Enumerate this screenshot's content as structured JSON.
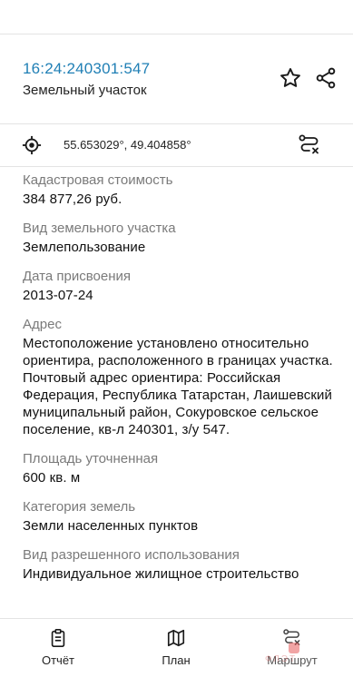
{
  "header": {
    "cadastral_number": "16:24:240301:547",
    "object_type": "Земельный участок",
    "favorite_icon": "star-outline-icon",
    "share_icon": "share-icon"
  },
  "location": {
    "coordinates": "55.653029°, 49.404858°",
    "locate_icon": "target-icon",
    "route_icon": "route-icon"
  },
  "properties": [
    {
      "label": "Кадастровая стоимость",
      "value": "384 877,26 руб."
    },
    {
      "label": "Вид земельного участка",
      "value": "Землепользование"
    },
    {
      "label": "Дата присвоения",
      "value": "2013-07-24"
    },
    {
      "label": "Адрес",
      "value": "Местоположение установлено относительно ориентира, расположенного в границах участка. Почтовый адрес ориентира: Российская Федерация, Республика Татарстан, Лаишевский муниципальный район, Сокуровское сельское поселение, кв-л 240301, з/у 547."
    },
    {
      "label": "Площадь уточненная",
      "value": "600 кв. м"
    },
    {
      "label": "Категория земель",
      "value": "Земли населенных пунктов"
    },
    {
      "label": "Вид разрешенного использования",
      "value": "Индивидуальное жилищное строительство"
    }
  ],
  "tabs": {
    "report": {
      "label": "Отчёт",
      "icon": "clipboard-icon"
    },
    "plan": {
      "label": "План",
      "icon": "map-icon"
    },
    "route": {
      "label": "Маршрут",
      "icon": "route-icon"
    }
  },
  "colors": {
    "accent": "#1f7fb5",
    "label": "#7a7a7a",
    "divider": "#e4e4e4"
  },
  "watermark": "ФЛЭТ"
}
